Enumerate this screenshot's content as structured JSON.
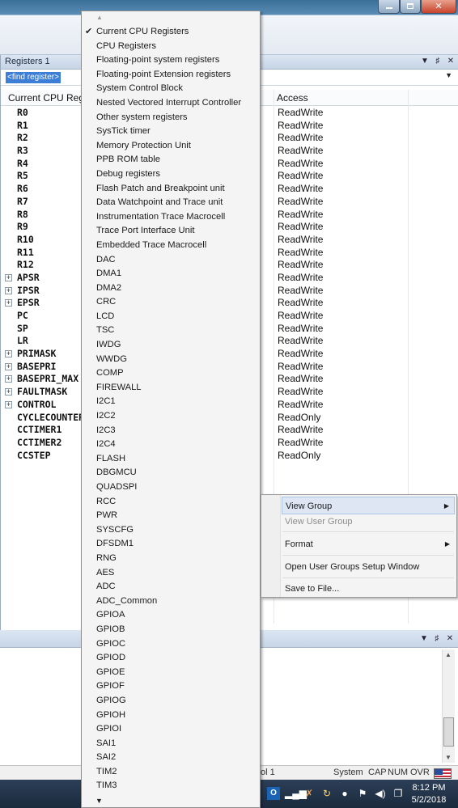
{
  "registers_panel": {
    "title": "Registers 1",
    "find_placeholder": "<find register>",
    "columns": [
      "Current CPU Registers",
      "Access"
    ],
    "rows": [
      {
        "name": "R0",
        "access": "ReadWrite",
        "expandable": false
      },
      {
        "name": "R1",
        "access": "ReadWrite",
        "expandable": false
      },
      {
        "name": "R2",
        "access": "ReadWrite",
        "expandable": false
      },
      {
        "name": "R3",
        "access": "ReadWrite",
        "expandable": false
      },
      {
        "name": "R4",
        "access": "ReadWrite",
        "expandable": false
      },
      {
        "name": "R5",
        "access": "ReadWrite",
        "expandable": false
      },
      {
        "name": "R6",
        "access": "ReadWrite",
        "expandable": false
      },
      {
        "name": "R7",
        "access": "ReadWrite",
        "expandable": false
      },
      {
        "name": "R8",
        "access": "ReadWrite",
        "expandable": false
      },
      {
        "name": "R9",
        "access": "ReadWrite",
        "expandable": false
      },
      {
        "name": "R10",
        "access": "ReadWrite",
        "expandable": false
      },
      {
        "name": "R11",
        "access": "ReadWrite",
        "expandable": false
      },
      {
        "name": "R12",
        "access": "ReadWrite",
        "expandable": false
      },
      {
        "name": "APSR",
        "access": "ReadWrite",
        "expandable": true
      },
      {
        "name": "IPSR",
        "access": "ReadWrite",
        "expandable": true
      },
      {
        "name": "EPSR",
        "access": "ReadWrite",
        "expandable": true
      },
      {
        "name": "PC",
        "access": "ReadWrite",
        "expandable": false
      },
      {
        "name": "SP",
        "access": "ReadWrite",
        "expandable": false
      },
      {
        "name": "LR",
        "access": "ReadWrite",
        "expandable": false
      },
      {
        "name": "PRIMASK",
        "access": "ReadWrite",
        "expandable": true
      },
      {
        "name": "BASEPRI",
        "access": "ReadWrite",
        "expandable": true
      },
      {
        "name": "BASEPRI_MAX",
        "access": "ReadWrite",
        "expandable": true
      },
      {
        "name": "FAULTMASK",
        "access": "ReadWrite",
        "expandable": true
      },
      {
        "name": "CONTROL",
        "access": "ReadWrite",
        "expandable": true
      },
      {
        "name": "CYCLECOUNTER",
        "access": "ReadOnly",
        "expandable": false
      },
      {
        "name": "CCTIMER1",
        "access": "ReadWrite",
        "expandable": false
      },
      {
        "name": "CCTIMER2",
        "access": "ReadWrite",
        "expandable": false
      },
      {
        "name": "CCSTEP",
        "access": "ReadOnly",
        "expandable": false
      }
    ]
  },
  "group_menu": {
    "selected": "Current CPU Registers",
    "items": [
      "Current CPU Registers",
      "CPU Registers",
      "Floating-point system registers",
      "Floating-point Extension registers",
      "System Control Block",
      "Nested Vectored Interrupt Controller",
      "Other system registers",
      "SysTick timer",
      "Memory Protection Unit",
      "PPB ROM table",
      "Debug registers",
      "Flash Patch and Breakpoint unit",
      "Data Watchpoint and Trace unit",
      "Instrumentation Trace Macrocell",
      "Trace Port Interface Unit",
      "Embedded Trace Macrocell",
      "DAC",
      "DMA1",
      "DMA2",
      "CRC",
      "LCD",
      "TSC",
      "IWDG",
      "WWDG",
      "COMP",
      "FIREWALL",
      "I2C1",
      "I2C2",
      "I2C3",
      "I2C4",
      "FLASH",
      "DBGMCU",
      "QUADSPI",
      "RCC",
      "PWR",
      "SYSCFG",
      "DFSDM1",
      "RNG",
      "AES",
      "ADC",
      "ADC_Common",
      "GPIOA",
      "GPIOB",
      "GPIOC",
      "GPIOD",
      "GPIOE",
      "GPIOF",
      "GPIOG",
      "GPIOH",
      "GPIOI",
      "SAI1",
      "SAI2",
      "TIM2",
      "TIM3"
    ]
  },
  "context_menu": {
    "view_group": "View Group",
    "view_user_group": "View User Group",
    "format": "Format",
    "open_setup": "Open User Groups Setup Window",
    "save": "Save to File..."
  },
  "status_bar": {
    "protocol_fragment": "ol 1",
    "system": "System",
    "cap": "CAP",
    "num": "NUM",
    "ovr": "OVR"
  },
  "taskbar": {
    "time": "8:12 PM",
    "date": "5/2/2018"
  },
  "icons": {
    "checkmark": "✔",
    "submenu_arrow": "▶",
    "scroll_up": "▲",
    "scroll_down": "▼",
    "expand": "+",
    "pane_dropdown": "▼",
    "pin": "♯",
    "close": "✕"
  },
  "colors": {
    "selection_blue": "#3d7fd6",
    "menu_bg": "#f4f4f4",
    "highlight_row": "#dde6f2"
  }
}
